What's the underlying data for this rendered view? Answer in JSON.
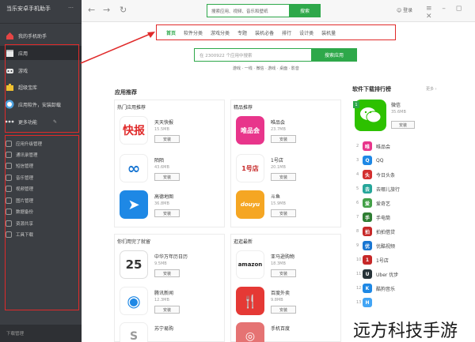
{
  "window": {
    "brand": "当乐安卓手机助手",
    "controls": "…"
  },
  "sidebar": {
    "header_item": "我的手机助手",
    "items": [
      {
        "label": "应用",
        "icon": "apps-icon"
      },
      {
        "label": "游戏",
        "icon": "gamepad-icon"
      },
      {
        "label": "超级宝库",
        "icon": "briefcase-icon"
      },
      {
        "label": "应用软件，安装卸载",
        "icon": "speed-icon"
      },
      {
        "label": "更多功能",
        "icon": "more-dots-icon"
      }
    ],
    "small_items": [
      "应用升级管理",
      "通讯录管理",
      "短信管理",
      "音乐管理",
      "视频管理",
      "图片管理",
      "数据备份",
      "资源共享",
      "工具下载"
    ],
    "footer": "下载管理"
  },
  "topbar": {
    "search_placeholder": "搜索应用、视频、音乐和壁纸",
    "search_button": "搜索",
    "user": "登录",
    "window_controls": "≡ – ◻ ✕"
  },
  "tabs": [
    {
      "label": "首页",
      "active": true
    },
    {
      "label": "软件分类",
      "active": false
    },
    {
      "label": "游戏分类",
      "active": false
    },
    {
      "label": "专题",
      "active": false
    },
    {
      "label": "装机必备",
      "active": false
    },
    {
      "label": "排行",
      "active": false
    },
    {
      "label": "设计类",
      "active": false
    },
    {
      "label": "装机量",
      "active": false
    }
  ],
  "main_search": {
    "placeholder": "在 2300922 个应用中搜索",
    "button": "搜索应用",
    "hot_words": "游戏 · 一线 · 微信 · 游戏 · 桌面 · 影音"
  },
  "recommend_title": "应用推荐",
  "panels": [
    {
      "title": "热门应用推荐",
      "apps": [
        {
          "name": "天天快报",
          "size": "15.5MB",
          "install": "安装",
          "icon_text": "快报",
          "icon_color": "#ffffff",
          "text_color": "#e02a2a"
        },
        {
          "name": "陌陌",
          "size": "43.6MB",
          "install": "安装",
          "icon_text": "∞",
          "icon_color": "#ffffff",
          "text_color": "#1976d2"
        },
        {
          "name": "高德地图",
          "size": "36.8MB",
          "install": "安装",
          "icon_text": "➤",
          "icon_color": "#1e88e5",
          "text_color": "#ffffff"
        }
      ]
    },
    {
      "title": "精品推荐",
      "apps": [
        {
          "name": "唯品会",
          "size": "23.7MB",
          "install": "安装",
          "icon_text": "唯品会",
          "icon_color": "#e8358b",
          "text_color": "#ffffff"
        },
        {
          "name": "1号店",
          "size": "20.1MB",
          "install": "安装",
          "icon_text": "1号店",
          "icon_color": "#ffffff",
          "text_color": "#c62828"
        },
        {
          "name": "斗鱼",
          "size": "15.9MB",
          "install": "安装",
          "icon_text": "douyu",
          "icon_color": "#f5a623",
          "text_color": "#ffffff"
        }
      ]
    },
    {
      "title": "你们用完了就留",
      "apps": [
        {
          "name": "中华万年历日历",
          "size": "9.5MB",
          "install": "安装",
          "icon_text": "25",
          "icon_color": "#ffffff",
          "text_color": "#333333"
        },
        {
          "name": "腾讯新闻",
          "size": "12.3MB",
          "install": "安装",
          "icon_text": "◉",
          "icon_color": "#ffffff",
          "text_color": "#1e88e5"
        },
        {
          "name": "苏宁易购",
          "size": "",
          "install": "",
          "icon_text": "S",
          "icon_color": "#ffffff",
          "text_color": "#999999"
        }
      ]
    },
    {
      "title": "逛逛最新",
      "apps": [
        {
          "name": "亚马逊购物",
          "size": "18.3MB",
          "install": "安装",
          "icon_text": "amazon",
          "icon_color": "#ffffff",
          "text_color": "#222222"
        },
        {
          "name": "百度外卖",
          "size": "9.8MB",
          "install": "安装",
          "icon_text": "🍴",
          "icon_color": "#e53935",
          "text_color": "#ffffff"
        },
        {
          "name": "手机百度",
          "size": "",
          "install": "",
          "icon_text": "◎",
          "icon_color": "#e57373",
          "text_color": "#ffffff"
        }
      ]
    }
  ],
  "ranking": {
    "title": "软件下载排行榜",
    "more": "更多 ›",
    "top": {
      "rank": "1",
      "name": "微信",
      "size": "35.6MB",
      "install": "安装"
    },
    "items": [
      {
        "rank": "2",
        "name": "唯品会",
        "icon_color": "#e8358b",
        "icon_text": "唯"
      },
      {
        "rank": "3",
        "name": "QQ",
        "icon_color": "#1e88e5",
        "icon_text": "Q"
      },
      {
        "rank": "4",
        "name": "今日头条",
        "icon_color": "#d32f2f",
        "icon_text": "头"
      },
      {
        "rank": "5",
        "name": "去哪儿旅行",
        "icon_color": "#26a69a",
        "icon_text": "去"
      },
      {
        "rank": "6",
        "name": "爱奇艺",
        "icon_color": "#43a047",
        "icon_text": "爱"
      },
      {
        "rank": "7",
        "name": "手电筒",
        "icon_color": "#2e7d32",
        "icon_text": "手"
      },
      {
        "rank": "8",
        "name": "拍拍借贷",
        "icon_color": "#c62828",
        "icon_text": "拍"
      },
      {
        "rank": "9",
        "name": "优酷视频",
        "icon_color": "#1976d2",
        "icon_text": "优"
      },
      {
        "rank": "10",
        "name": "1号店",
        "icon_color": "#c62828",
        "icon_text": "1"
      },
      {
        "rank": "11",
        "name": "Uber 优步",
        "icon_color": "#263238",
        "icon_text": "U"
      },
      {
        "rank": "12",
        "name": "酷狗音乐",
        "icon_color": "#1e88e5",
        "icon_text": "K"
      },
      {
        "rank": "13",
        "name": "",
        "icon_color": "#42a5f5",
        "icon_text": "H"
      }
    ]
  },
  "watermark": "远方科技手游"
}
